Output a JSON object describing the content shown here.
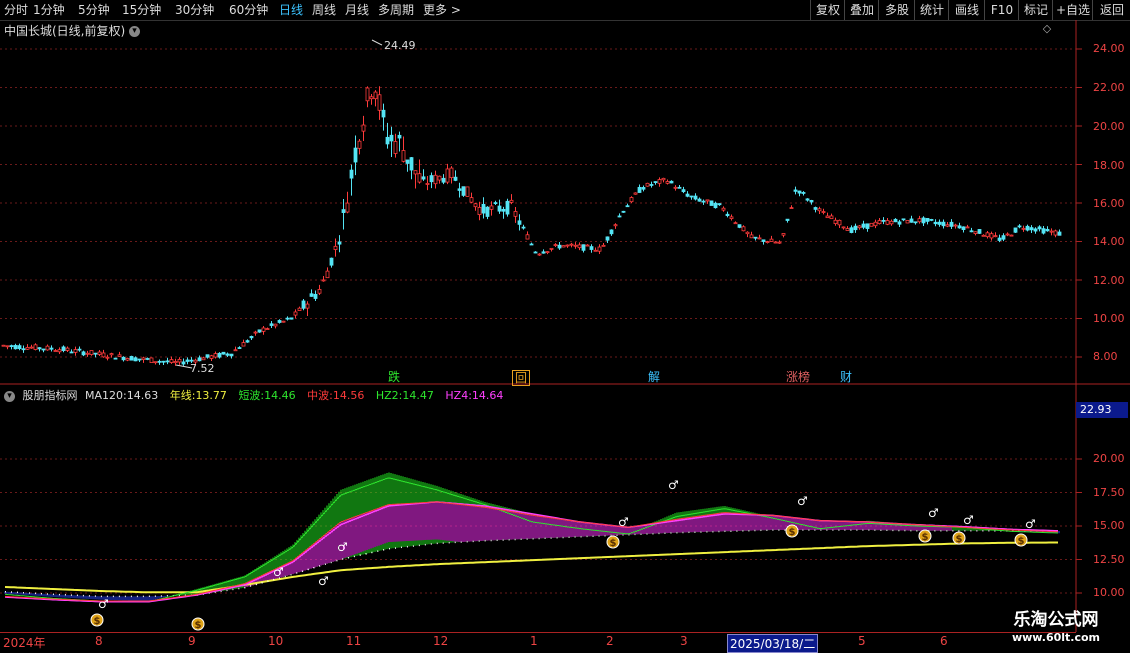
{
  "toolbar": {
    "periods": [
      "分时",
      "1分钟",
      "5分钟",
      "15分钟",
      "30分钟",
      "60分钟",
      "日线",
      "周线",
      "月线",
      "多周期",
      "更多 >"
    ],
    "active_period": "日线",
    "right_buttons": [
      "复权",
      "叠加",
      "多股",
      "统计",
      "画线",
      "F10",
      "标记",
      "+自选",
      "返回"
    ]
  },
  "stock_title": "中国长城(日线,前复权)",
  "price_annotations": {
    "high": "24.49",
    "low": "7.52"
  },
  "event_markers": [
    {
      "label": "跌",
      "color": "#2ee62e"
    },
    {
      "label": "回",
      "color": "#e8a020"
    },
    {
      "label": "解",
      "color": "#3cc3ff"
    },
    {
      "label": "涨榜",
      "color": "#e06060"
    },
    {
      "label": "财",
      "color": "#3cc3ff"
    }
  ],
  "indicator": {
    "name": "股朋指标网",
    "items": [
      {
        "label": "MA120:",
        "value": "14.63",
        "color": "#dddddd"
      },
      {
        "label": "年线:",
        "value": "13.77",
        "color": "#f0f040"
      },
      {
        "label": "短波:",
        "value": "14.46",
        "color": "#2ee62e"
      },
      {
        "label": "中波:",
        "value": "14.56",
        "color": "#ff3b3b"
      },
      {
        "label": "HZ2:",
        "value": "14.47",
        "color": "#2ee62e"
      },
      {
        "label": "HZ4:",
        "value": "14.64",
        "color": "#ff40ff"
      }
    ],
    "tag_value": "22.93"
  },
  "price_axis": [
    "24.00",
    "22.00",
    "20.00",
    "18.00",
    "16.00",
    "14.00",
    "12.00",
    "10.00",
    "8.00"
  ],
  "indicator_axis": [
    "20.00",
    "17.50",
    "15.00",
    "12.50",
    "10.00"
  ],
  "date_axis": {
    "ticks": [
      "2024年",
      "8",
      "9",
      "10",
      "11",
      "12",
      "1",
      "2",
      "3",
      "5",
      "6"
    ],
    "highlight": "2025/03/18/二"
  },
  "watermark": {
    "line1": "乐淘公式网",
    "line2": "www.60lt.com"
  },
  "chart_data": {
    "type": "line",
    "series": [
      {
        "name": "年线",
        "values": [
          10.45,
          10.3,
          10.15,
          10.05,
          10.05,
          10.6,
          11.2,
          11.7,
          11.95,
          12.15,
          12.3,
          12.45,
          12.6,
          12.75,
          12.9,
          13.05,
          13.2,
          13.35,
          13.5,
          13.6,
          13.7,
          13.75,
          13.77
        ]
      },
      {
        "name": "MA120",
        "values": [
          10.1,
          9.9,
          9.75,
          9.75,
          9.85,
          10.4,
          11.4,
          12.5,
          13.3,
          13.7,
          13.9,
          14.05,
          14.2,
          14.35,
          14.5,
          14.6,
          14.7,
          14.7,
          14.7,
          14.65,
          14.65,
          14.63,
          14.63
        ]
      },
      {
        "name": "短波",
        "values": [
          9.95,
          9.7,
          9.5,
          9.4,
          10.3,
          11.3,
          13.6,
          17.7,
          19.0,
          18.0,
          16.8,
          15.9,
          15.1,
          14.5,
          16.0,
          16.5,
          15.7,
          14.9,
          15.4,
          15.1,
          15.0,
          14.6,
          14.46
        ]
      },
      {
        "name": "中波",
        "values": [
          9.75,
          9.55,
          9.4,
          9.4,
          9.9,
          10.7,
          12.4,
          15.3,
          16.6,
          16.8,
          16.4,
          15.8,
          15.3,
          14.9,
          15.5,
          16.0,
          15.8,
          15.4,
          15.3,
          15.1,
          14.9,
          14.7,
          14.56
        ]
      },
      {
        "name": "HZ2",
        "values": [
          9.9,
          9.6,
          9.4,
          9.35,
          10.2,
          11.2,
          13.4,
          17.3,
          18.6,
          17.7,
          16.6,
          15.3,
          14.8,
          14.4,
          15.7,
          16.3,
          15.6,
          14.8,
          15.2,
          15.0,
          14.9,
          14.6,
          14.47
        ]
      },
      {
        "name": "HZ4",
        "values": [
          9.7,
          9.5,
          9.35,
          9.35,
          9.85,
          10.6,
          12.3,
          15.1,
          16.5,
          16.8,
          16.5,
          15.9,
          15.3,
          14.9,
          15.4,
          15.9,
          15.8,
          15.4,
          15.3,
          15.1,
          14.95,
          14.75,
          14.64
        ]
      }
    ]
  }
}
